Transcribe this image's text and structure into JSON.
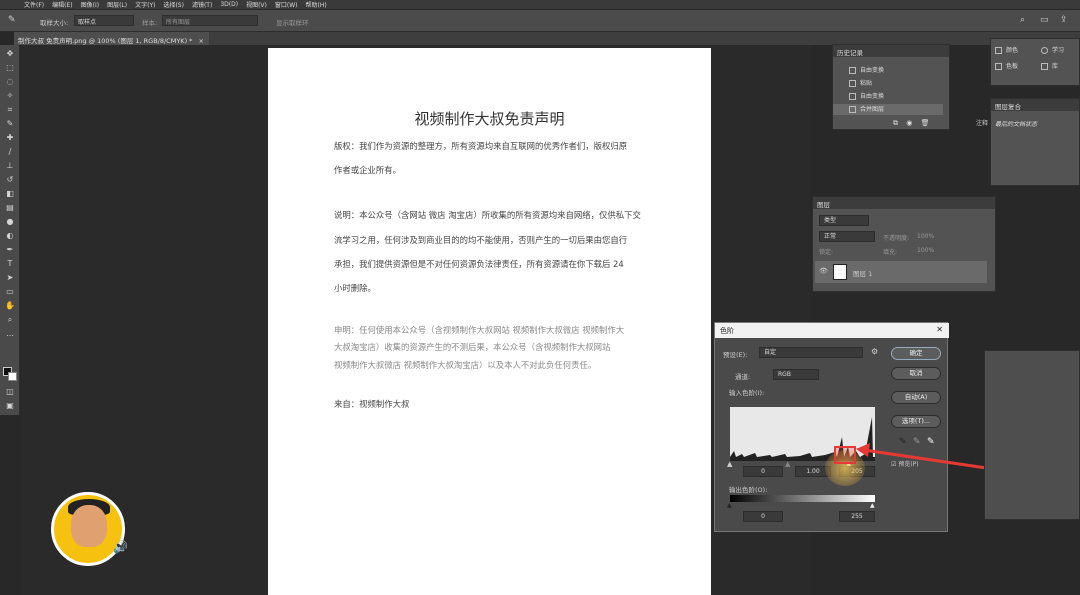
{
  "menubar": {
    "items": [
      "文件(F)",
      "编辑(E)",
      "图像(I)",
      "图层(L)",
      "文字(Y)",
      "选择(S)",
      "滤镜(T)",
      "3D(D)",
      "视图(V)",
      "窗口(W)",
      "帮助(H)"
    ]
  },
  "options": {
    "sample_size_label": "取样大小:",
    "sample_size_value": "取样点",
    "sample_label": "样本:",
    "sample_value": "所有图层",
    "show_ring": "显示取样环"
  },
  "tab": {
    "title": "制作大叔 免责声明.png @ 100% (图层 1, RGB/8/CMYK) *",
    "close": "×"
  },
  "document": {
    "title": "视频制作大叔免责声明",
    "p1_line1": "版权：我们作为资源的整理方，所有资源均来自互联网的优秀作者们，版权归原",
    "p1_line2": "作者或企业所有。",
    "p2_line1": "说明：本公众号（含网站 微店 淘宝店）所收集的所有资源均来自网络，仅供私下交",
    "p2_line2": "流学习之用，任何涉及到商业目的的均不能使用，否则产生的一切后果由您自行",
    "p2_line3": "承担，我们提供资源但是不对任何资源负法律责任，所有资源请在你下载后 24",
    "p2_line4": "小时删除。",
    "p3_line1": "申明：任何使用本公众号（含视频制作大叔网站 视频制作大叔微店 视频制作大",
    "p3_line2": "大叔淘宝店）收集的资源产生的不测后果，本公众号（含视频制作大叔网站",
    "p3_line3": "视频制作大叔微店 视频制作大叔淘宝店）以及本人不对此负任何责任。",
    "p4_line1": "来自：视频制作大叔"
  },
  "history": {
    "title": "历史记录",
    "items": [
      "自由变换",
      "粘贴",
      "自由变换",
      "合并图层"
    ]
  },
  "color_panel": {
    "color": "颜色",
    "swatches": "色板",
    "learn": "学习",
    "library": "库"
  },
  "props_panel": {
    "title": "图层复合",
    "tab_label": "注释",
    "hint": "最后的文档状态"
  },
  "layers": {
    "title": "图层",
    "kind": "类型",
    "mode": "正常",
    "opacity_label": "不透明度:",
    "opacity_value": "100%",
    "lock_label": "锁定:",
    "fill_label": "填充:",
    "fill_value": "100%",
    "layer_name": "图层 1"
  },
  "levels": {
    "title": "色阶",
    "preset_label": "预设(E):",
    "preset_value": "自定",
    "channel_label": "通道:",
    "channel_value": "RGB",
    "input_label": "输入色阶(I):",
    "output_label": "输出色阶(O):",
    "input_black": "0",
    "input_gamma": "1.00",
    "input_white": "205",
    "output_black": "0",
    "output_white": "255",
    "ok": "确定",
    "cancel": "取消",
    "auto": "自动(A)",
    "options": "选项(T)...",
    "preview": "预览(P)"
  },
  "colors": {
    "accent_red": "#e53935",
    "panel": "#535353",
    "canvas": "#ffffff"
  }
}
